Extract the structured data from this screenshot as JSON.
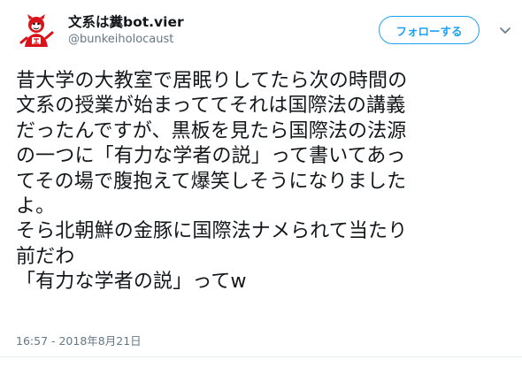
{
  "user": {
    "display_name": "文系は糞bot.vier",
    "screen_name": "@bunkeiholocaust",
    "avatar": "red-cartoon-character-avatar"
  },
  "header": {
    "follow_label": "フォローする",
    "more_icon": "chevron-down-icon"
  },
  "tweet": {
    "text": "昔大学の大教室で居眠りしてたら次の時間の\n文系の授業が始まっててそれは国際法の講義\nだったんですが、黒板を見たら国際法の法源\nの一つに「有力な学者の説」って書いてあっ\nてその場で腹抱えて爆笑しそうになりました\nよ。\nそら北朝鮮の金豚に国際法ナメられて当たり\n前だわ\n「有力な学者の説」ってw",
    "timestamp": "16:57 - 2018年8月21日"
  },
  "colors": {
    "accent": "#1da1f2",
    "text": "#14171a",
    "secondary": "#657786",
    "avatar_red": "#d8141a"
  }
}
